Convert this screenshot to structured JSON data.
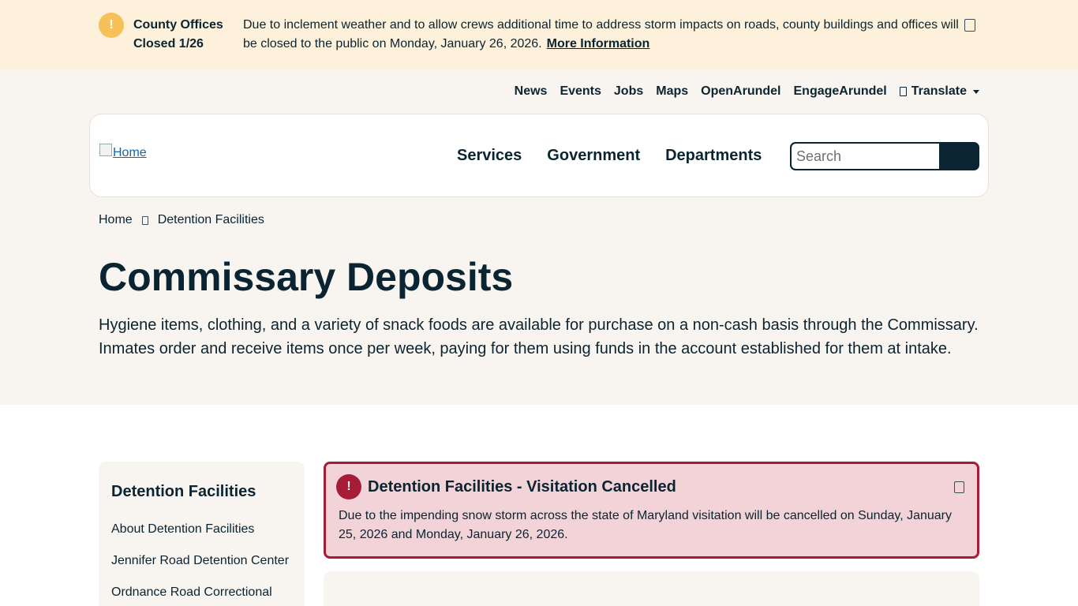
{
  "alert": {
    "icon": "exclamation-icon",
    "icon_glyph": "!",
    "title": "County Offices Closed 1/26",
    "text": "Due to inclement weather and to allow crews additional time to address storm impacts on roads, county buildings and offices will be closed to the public on Monday, January 26, 2026.",
    "link_label": "More Information",
    "close_icon": "close-icon",
    "background": "#fdf1dc",
    "icon_color": "#f7c15a"
  },
  "utility_nav": {
    "items": [
      "News",
      "Events",
      "Jobs",
      "Maps",
      "OpenArundel",
      "EngageArundel"
    ],
    "translate_label": "Translate"
  },
  "header": {
    "logo_alt": "Home",
    "nav": [
      "Services",
      "Government",
      "Departments"
    ],
    "search_placeholder": "Search"
  },
  "breadcrumb": {
    "home": "Home",
    "current": "Detention Facilities"
  },
  "page": {
    "title": "Commissary Deposits",
    "intro": "Hygiene items, clothing, and a variety of snack foods are available for purchase on a non-cash basis through the Commissary. Inmates order and receive items once per week, paying for them using funds in the account established for them at intake."
  },
  "sidebar": {
    "title": "Detention Facilities",
    "items": [
      "About Detention Facilities",
      "Jennifer Road Detention Center",
      "Ordnance Road Correctional"
    ]
  },
  "notice": {
    "icon_glyph": "!",
    "title": "Detention Facilities - Visitation Cancelled",
    "text": "Due to the impending snow storm across the state of Maryland visitation will be cancelled on Sunday, January 25, 2026 and Monday, January 26, 2026.",
    "color": "#a61c37",
    "background": "#f1d3d8"
  },
  "colors": {
    "brand_dark": "#0b2431",
    "page_bg": "#f8f4ef"
  }
}
